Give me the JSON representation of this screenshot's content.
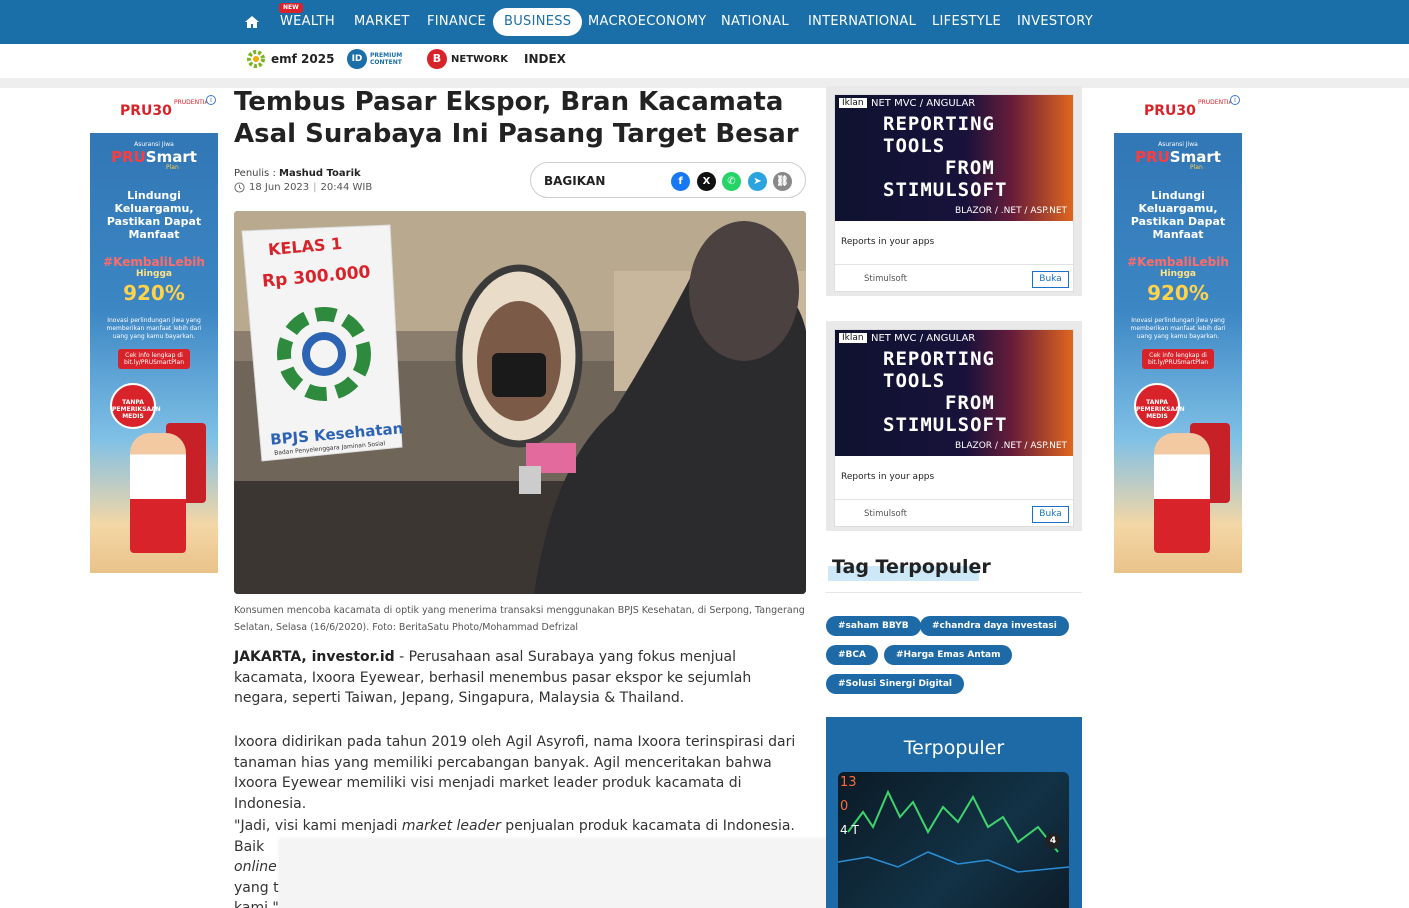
{
  "nav": {
    "new_badge": "NEW",
    "items": [
      "WEALTH",
      "MARKET",
      "FINANCE",
      "BUSINESS",
      "MACROECONOMY",
      "NATIONAL",
      "INTERNATIONAL",
      "LIFESTYLE",
      "INVESTORY"
    ],
    "active": "BUSINESS"
  },
  "subnav": {
    "emf": "emf 2025",
    "id_logo": "ID",
    "id_text": "PREMIUM CONTENT",
    "network_logo": "B",
    "network_text": "NETWORK",
    "index": "INDEX"
  },
  "side_ad": {
    "brand": "PRU30",
    "brand_sub": "PRUDENTIAL",
    "tagline_top": "Asuransi Jiwa",
    "product_pre": "PRU",
    "product_post": "Smart",
    "product_sub": "Plan",
    "headline": "Lindungi Keluargamu, Pastikan Dapat Manfaat",
    "hashtag": "#KembaliLebih",
    "upto": "Hingga",
    "percent": "920%",
    "desc": "Inovasi perlindungan jiwa yang memberikan manfaat lebih dari uang yang kamu bayarkan.",
    "cta": "Cek info lengkap di bit.ly/PRUSmartPlan",
    "badge": "TANPA PEMERIKSAAN MEDIS"
  },
  "article": {
    "headline": "Tembus Pasar Ekspor, Bran Kacamata Asal Surabaya Ini Pasang Target Besar",
    "author_label": "Penulis :",
    "author": "Mashud Toarik",
    "date": "18 Jun 2023",
    "time": "20:44 WIB",
    "share_label": "BAGIKAN",
    "photo": {
      "sign_line1": "KELAS 1",
      "sign_line2": "Rp 300.000",
      "sign_brand": "BPJS Kesehatan",
      "sign_sub": "Badan Penyelenggara Jaminan Sosial"
    },
    "caption": "Konsumen mencoba kacamata di optik yang menerima transaksi menggunakan BPJS Kesehatan, di Serpong, Tangerang Selatan, Selasa (16/6/2020). Foto: BeritaSatu Photo/Mohammad Defrizal",
    "p1_lead": "JAKARTA, investor.id",
    "p1_body": " - Perusahaan asal Surabaya yang fokus menjual kacamata, Ixoora Eyewear, berhasil menembus pasar ekspor ke sejumlah negara, seperti Taiwan, Jepang, Singapura, Malaysia & Thailand.",
    "p2": "Ixoora didirikan pada tahun 2019 oleh Agil Asyrofi, nama Ixoora terinspirasi dari tanaman hias yang memiliki percabangan banyak. Agil menceritakan bahwa Ixoora Eyewear memiliki visi menjadi market leader produk kacamata di Indonesia.",
    "p3_a": "\"Jadi, visi kami menjadi ",
    "p3_b": "market leader",
    "p3_c": " penjualan produk kacamata di Indonesia. Baik",
    "p3_d": "online",
    "p3_e": "yang te",
    "p3_f": "kami,\""
  },
  "right_ads": {
    "iklan": "Iklan",
    "sub1": "NET MVC / ANGULAR",
    "line1": "REPORTING",
    "line2": "TOOLS",
    "line3": "FROM",
    "line4": "STIMULSOFT",
    "sub2": "BLAZOR / .NET / ASP.NET",
    "text": "Reports in your apps",
    "company": "Stimulsoft",
    "button": "Buka"
  },
  "tags": {
    "title": "Tag Terpopuler",
    "items": [
      "#saham BBYB",
      "#chandra daya investasi",
      "#BCA",
      "#Harga Emas Antam",
      "#Solusi Sinergi Digital"
    ]
  },
  "terpopuler": {
    "title": "Terpopuler",
    "rank": "4"
  },
  "colors": {
    "nav_blue": "#1b6fa8",
    "tag_blue": "#1e6aa6",
    "prudential_red": "#d8232a"
  }
}
